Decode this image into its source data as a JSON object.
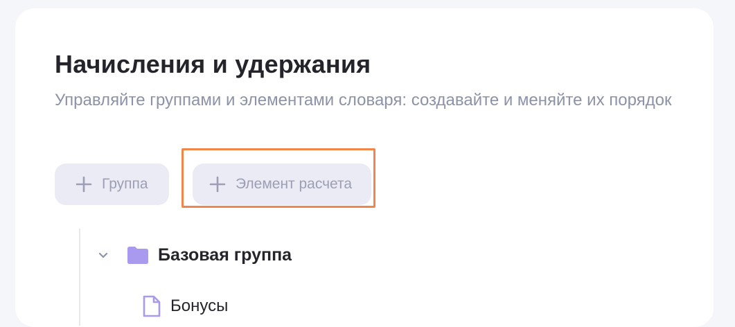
{
  "header": {
    "title": "Начисления и удержания",
    "subtitle": "Управляйте группами и элементами словаря: создавайте и меняйте их порядок"
  },
  "toolbar": {
    "add_group_label": "Группа",
    "add_element_label": "Элемент расчета"
  },
  "tree": {
    "groups": [
      {
        "label": "Базовая группа",
        "expanded": true,
        "items": [
          {
            "label": "Бонусы"
          }
        ]
      }
    ]
  },
  "icons": {
    "add_group": "plus-icon",
    "add_element": "plus-icon",
    "expand": "chevron-down-icon",
    "group": "folder-icon",
    "item": "document-icon"
  },
  "colors": {
    "background": "#f5f6f9",
    "card": "#ffffff",
    "title": "#24252b",
    "subtitle": "#8c92a8",
    "button_bg": "#ebebf6",
    "button_text": "#9c9fb3",
    "folder": "#a99af0",
    "highlight": "#f0874a"
  }
}
